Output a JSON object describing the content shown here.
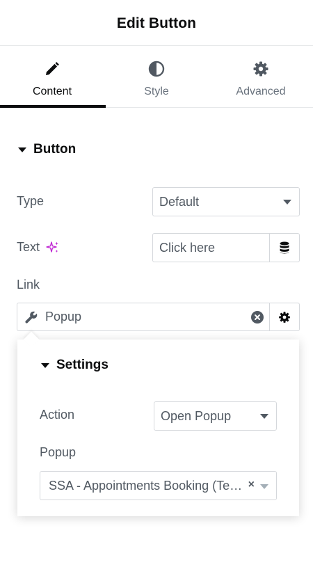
{
  "panel": {
    "title": "Edit Button"
  },
  "tabs": [
    {
      "label": "Content",
      "icon": "pencil-icon",
      "active": true
    },
    {
      "label": "Style",
      "icon": "contrast-icon",
      "active": false
    },
    {
      "label": "Advanced",
      "icon": "gear-icon",
      "active": false
    }
  ],
  "section": {
    "title": "Button"
  },
  "fields": {
    "type": {
      "label": "Type",
      "value": "Default"
    },
    "text": {
      "label": "Text",
      "value": "Click here",
      "ai_icon": "sparkle-icon",
      "dynamic_icon": "database-icon"
    },
    "link": {
      "label": "Link",
      "value": "Popup",
      "icon": "wrench-icon",
      "clear_icon": "clear-icon",
      "settings_icon": "gear-icon"
    }
  },
  "popover": {
    "title": "Settings",
    "action": {
      "label": "Action",
      "value": "Open Popup"
    },
    "popup": {
      "label": "Popup",
      "value": "SSA - Appointments Booking (Template)",
      "clear": "×"
    }
  },
  "colors": {
    "accent_ai": "#c026d3",
    "text": "#515962",
    "heading": "#0c0d0e",
    "border": "#d5d8dc"
  }
}
